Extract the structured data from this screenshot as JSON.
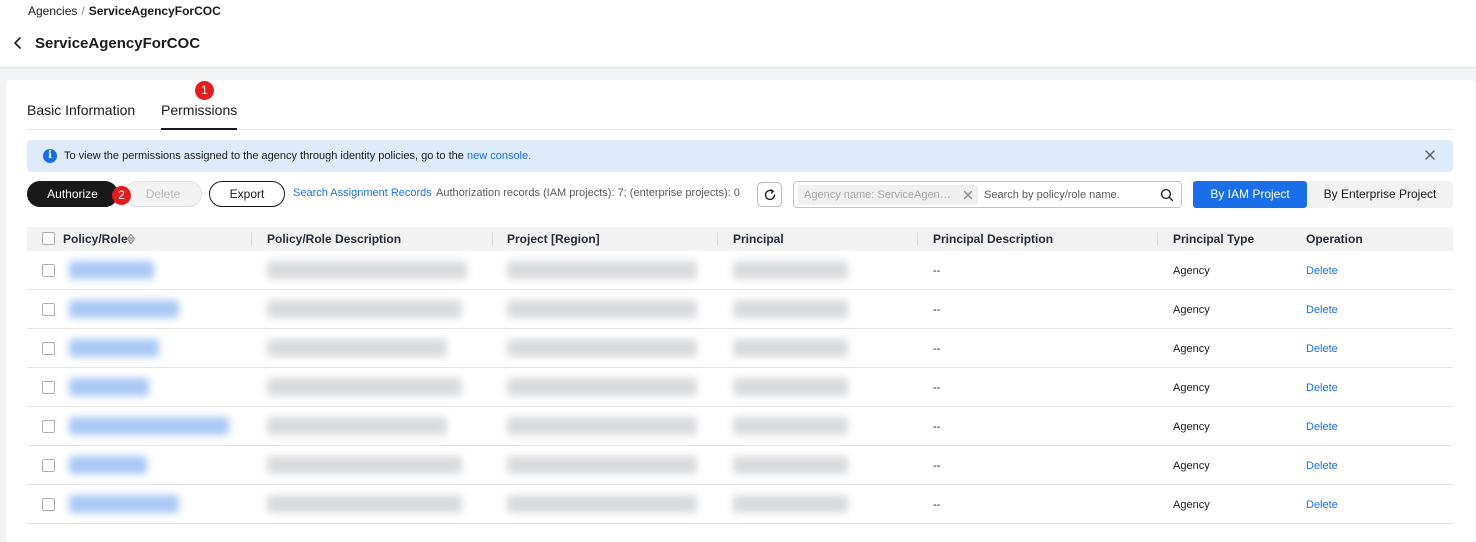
{
  "breadcrumb": {
    "parent": "Agencies",
    "separator": "/",
    "current": "ServiceAgencyForCOC"
  },
  "page": {
    "title": "ServiceAgencyForCOC"
  },
  "tabs": [
    {
      "label": "Basic Information",
      "active": false
    },
    {
      "label": "Permissions",
      "active": true
    }
  ],
  "steps": {
    "step1": "1",
    "step2": "2"
  },
  "notice": {
    "text": "To view the permissions assigned to the agency through identity policies, go to the ",
    "link": "new console."
  },
  "toolbar": {
    "authorize_label": "Authorize",
    "delete_label": "Delete",
    "export_label": "Export",
    "search_records_label": "Search Assignment Records",
    "records_text": "Authorization records (IAM projects): 7; (enterprise projects): 0"
  },
  "search": {
    "tag": "Agency name: ServiceAgencyForCOC",
    "placeholder": "Search by policy/role name.",
    "value": ""
  },
  "segments": {
    "iam": "By IAM Project",
    "enterprise": "By Enterprise Project",
    "selected": "iam"
  },
  "table": {
    "columns": [
      "Policy/Role",
      "Policy/Role Description",
      "Project [Region]",
      "Principal",
      "Principal Description",
      "Principal Type",
      "Operation"
    ],
    "rows": [
      {
        "description": "--",
        "type": "Agency",
        "operation": "Delete"
      },
      {
        "description": "--",
        "type": "Agency",
        "operation": "Delete"
      },
      {
        "description": "--",
        "type": "Agency",
        "operation": "Delete"
      },
      {
        "description": "--",
        "type": "Agency",
        "operation": "Delete"
      },
      {
        "description": "--",
        "type": "Agency",
        "operation": "Delete"
      },
      {
        "description": "--",
        "type": "Agency",
        "operation": "Delete"
      },
      {
        "description": "--",
        "type": "Agency",
        "operation": "Delete"
      }
    ]
  },
  "colors": {
    "accent": "#1a6fe8",
    "badge": "#e11d1d",
    "primary_button": "#191919",
    "notice_bg": "#deebfc"
  }
}
